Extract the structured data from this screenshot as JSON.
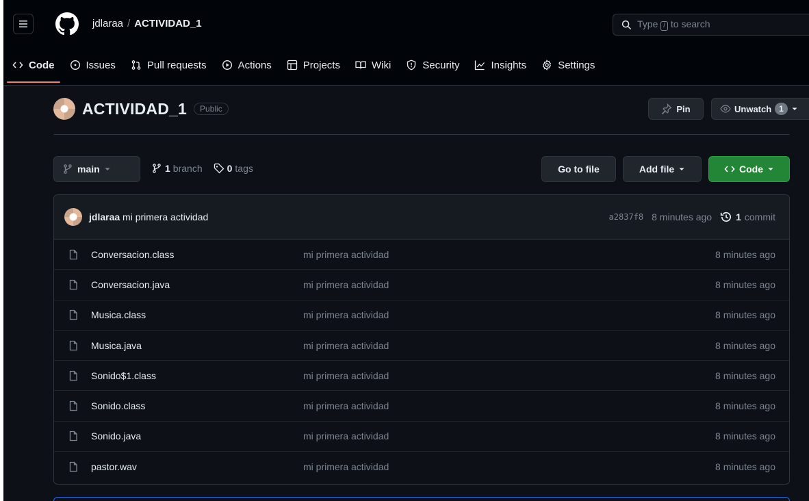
{
  "header": {
    "owner": "jdlaraa",
    "separator": "/",
    "repo": "ACTIVIDAD_1",
    "search_pre": "Type",
    "search_key": "/",
    "search_post": "to search"
  },
  "tabs": [
    {
      "label": "Code",
      "icon": "code-icon",
      "selected": true
    },
    {
      "label": "Issues",
      "icon": "issue-icon"
    },
    {
      "label": "Pull requests",
      "icon": "pull-request-icon"
    },
    {
      "label": "Actions",
      "icon": "play-icon"
    },
    {
      "label": "Projects",
      "icon": "table-icon"
    },
    {
      "label": "Wiki",
      "icon": "book-icon"
    },
    {
      "label": "Security",
      "icon": "shield-icon"
    },
    {
      "label": "Insights",
      "icon": "graph-icon"
    },
    {
      "label": "Settings",
      "icon": "gear-icon"
    }
  ],
  "repo": {
    "title": "ACTIVIDAD_1",
    "visibility": "Public",
    "pin_label": "Pin",
    "watch_label": "Unwatch",
    "watch_count": "1"
  },
  "toolbar": {
    "branch": "main",
    "branch_count": "1",
    "branch_word": "branch",
    "tag_count": "0",
    "tag_word": "tags",
    "goto_label": "Go to file",
    "addfile_label": "Add file",
    "code_label": "Code"
  },
  "commit": {
    "author": "jdlaraa",
    "message": "mi primera actividad",
    "sha": "a2837f8",
    "time": "8 minutes ago",
    "count": "1",
    "count_word": "commit"
  },
  "files": [
    {
      "name": "Conversacion.class",
      "message": "mi primera actividad",
      "time": "8 minutes ago"
    },
    {
      "name": "Conversacion.java",
      "message": "mi primera actividad",
      "time": "8 minutes ago"
    },
    {
      "name": "Musica.class",
      "message": "mi primera actividad",
      "time": "8 minutes ago"
    },
    {
      "name": "Musica.java",
      "message": "mi primera actividad",
      "time": "8 minutes ago"
    },
    {
      "name": "Sonido$1.class",
      "message": "mi primera actividad",
      "time": "8 minutes ago"
    },
    {
      "name": "Sonido.class",
      "message": "mi primera actividad",
      "time": "8 minutes ago"
    },
    {
      "name": "Sonido.java",
      "message": "mi primera actividad",
      "time": "8 minutes ago"
    },
    {
      "name": "pastor.wav",
      "message": "mi primera actividad",
      "time": "8 minutes ago"
    }
  ],
  "colors": {
    "background": "#0d1117",
    "header": "#010409",
    "accent_tab": "#f78166",
    "green_button": "#238636",
    "muted": "#7d8590"
  }
}
